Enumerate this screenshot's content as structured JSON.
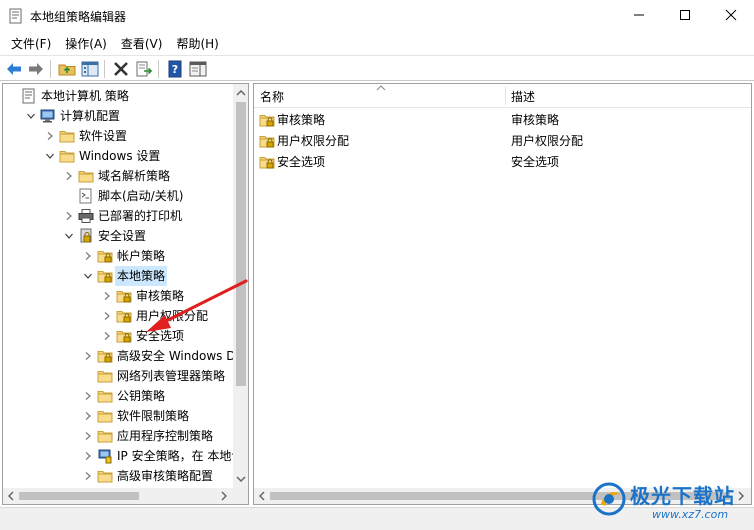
{
  "window": {
    "title": "本地组策略编辑器"
  },
  "menu": [
    "文件(F)",
    "操作(A)",
    "查看(V)",
    "帮助(H)"
  ],
  "tree": [
    {
      "label": "本地计算机 策略",
      "icon": "policy-doc-icon",
      "twisty": "none"
    },
    {
      "label": "计算机配置",
      "icon": "computer-icon",
      "twisty": "expanded"
    },
    {
      "label": "软件设置",
      "icon": "folder-icon",
      "twisty": "collapsed"
    },
    {
      "label": "Windows 设置",
      "icon": "folder-icon",
      "twisty": "expanded"
    },
    {
      "label": "域名解析策略",
      "icon": "folder-icon",
      "twisty": "collapsed"
    },
    {
      "label": "脚本(启动/关机)",
      "icon": "script-icon",
      "twisty": "none"
    },
    {
      "label": "已部署的打印机",
      "icon": "printer-icon",
      "twisty": "collapsed"
    },
    {
      "label": "安全设置",
      "icon": "security-settings-icon",
      "twisty": "expanded"
    },
    {
      "label": "帐户策略",
      "icon": "locked-folder-icon",
      "twisty": "collapsed"
    },
    {
      "label": "本地策略",
      "icon": "locked-folder-icon",
      "twisty": "expanded"
    },
    {
      "label": "审核策略",
      "icon": "locked-folder-icon",
      "twisty": "collapsed"
    },
    {
      "label": "用户权限分配",
      "icon": "locked-folder-icon",
      "twisty": "collapsed"
    },
    {
      "label": "安全选项",
      "icon": "locked-folder-icon",
      "twisty": "collapsed"
    },
    {
      "label": "高级安全 Windows Def",
      "icon": "locked-folder-icon",
      "twisty": "collapsed"
    },
    {
      "label": "网络列表管理器策略",
      "icon": "folder-icon",
      "twisty": "none"
    },
    {
      "label": "公钥策略",
      "icon": "folder-icon",
      "twisty": "collapsed"
    },
    {
      "label": "软件限制策略",
      "icon": "folder-icon",
      "twisty": "collapsed"
    },
    {
      "label": "应用程序控制策略",
      "icon": "folder-icon",
      "twisty": "collapsed"
    },
    {
      "label": "IP 安全策略，在 本地计",
      "icon": "ip-security-icon",
      "twisty": "collapsed"
    },
    {
      "label": "高级审核策略配置",
      "icon": "folder-icon",
      "twisty": "collapsed"
    }
  ],
  "list": {
    "columns": [
      "名称",
      "描述"
    ],
    "rows": [
      {
        "name": "审核策略",
        "desc": "审核策略"
      },
      {
        "name": "用户权限分配",
        "desc": "用户权限分配"
      },
      {
        "name": "安全选项",
        "desc": "安全选项"
      }
    ]
  },
  "watermark": {
    "text": "极光下载站",
    "url": "www.xz7.com"
  },
  "colors": {
    "selection": "#cce8ff",
    "arrow": "#e02020",
    "watermark": "#1a73c8"
  }
}
